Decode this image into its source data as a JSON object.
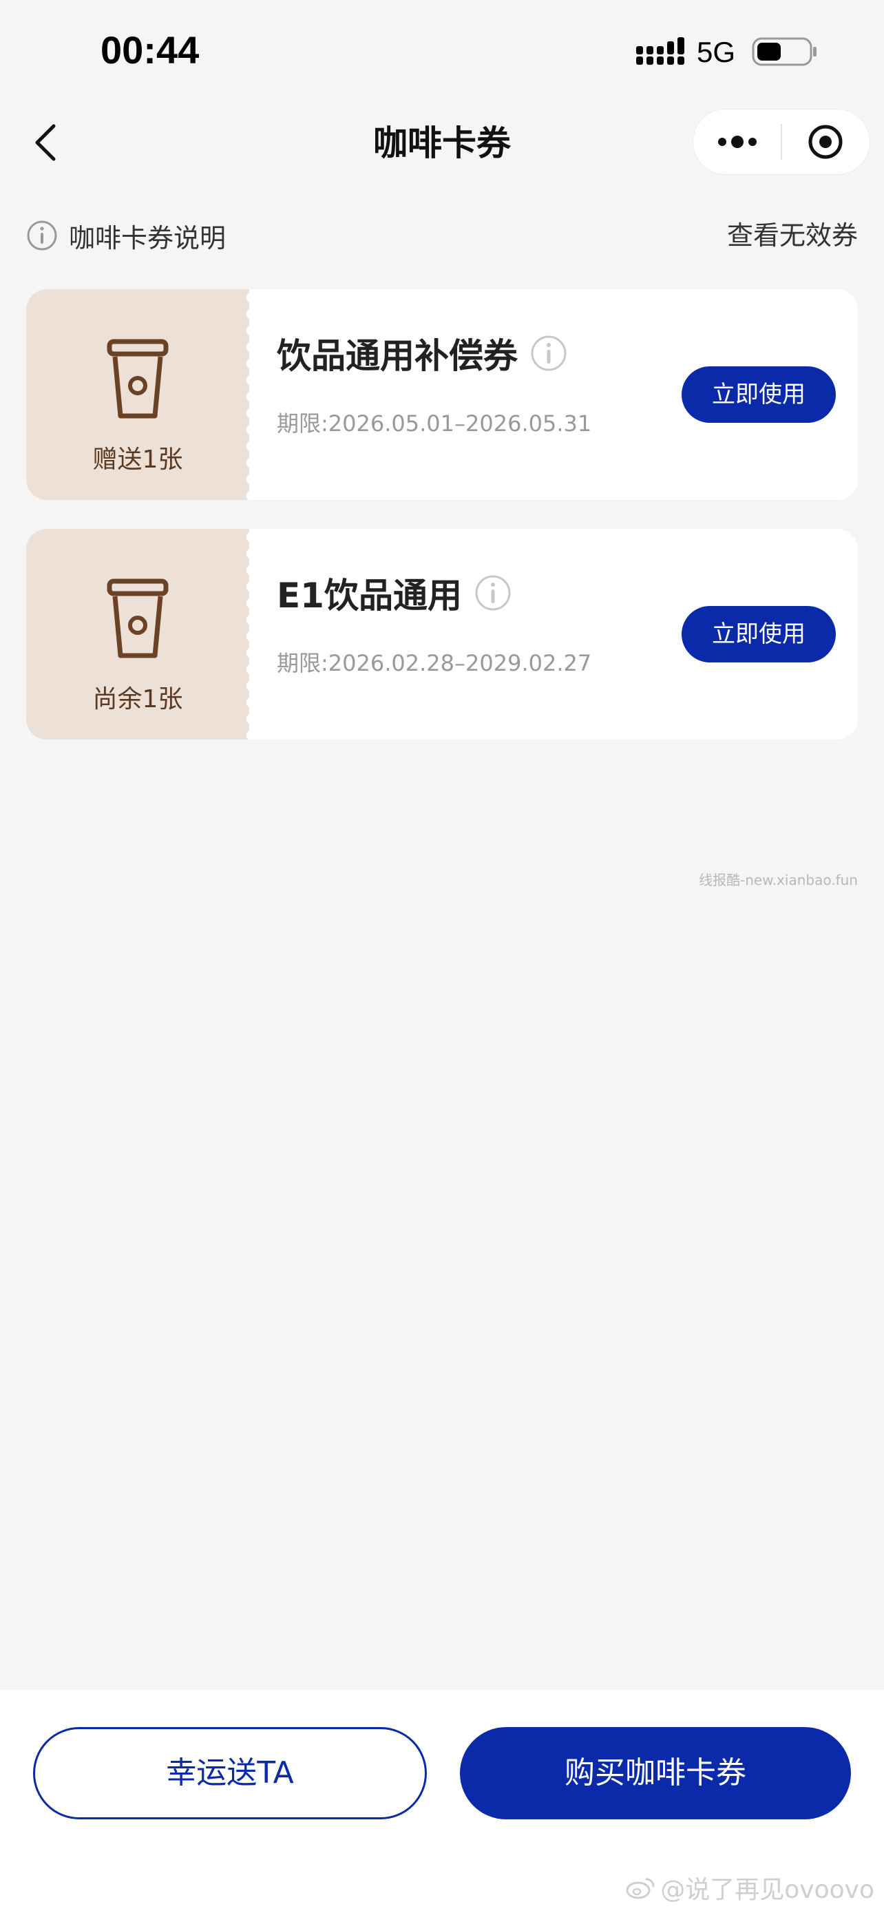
{
  "status_bar": {
    "time": "00:44",
    "network": "5G"
  },
  "nav": {
    "title": "咖啡卡券"
  },
  "subheader": {
    "info_label": "咖啡卡券说明",
    "invalid_label": "查看无效券"
  },
  "coupons": [
    {
      "name": "饮品通用补偿券",
      "date": "期限:2026.05.01–2026.05.31",
      "count": "赠送1张",
      "button": "立即使用"
    },
    {
      "name": "E1饮品通用",
      "date": "期限:2026.02.28–2029.02.27",
      "count": "尚余1张",
      "button": "立即使用"
    }
  ],
  "watermark_site": "线报酷-new.xianbao.fun",
  "bottom": {
    "gift_label": "幸运送TA",
    "buy_label": "购买咖啡卡券"
  },
  "watermark_user": "@说了再见ovoovo",
  "colors": {
    "primary": "#0a2aa9",
    "coupon_left_bg": "#ede1d7",
    "cup_brown": "#6b4226",
    "page_bg": "#f5f5f5"
  }
}
